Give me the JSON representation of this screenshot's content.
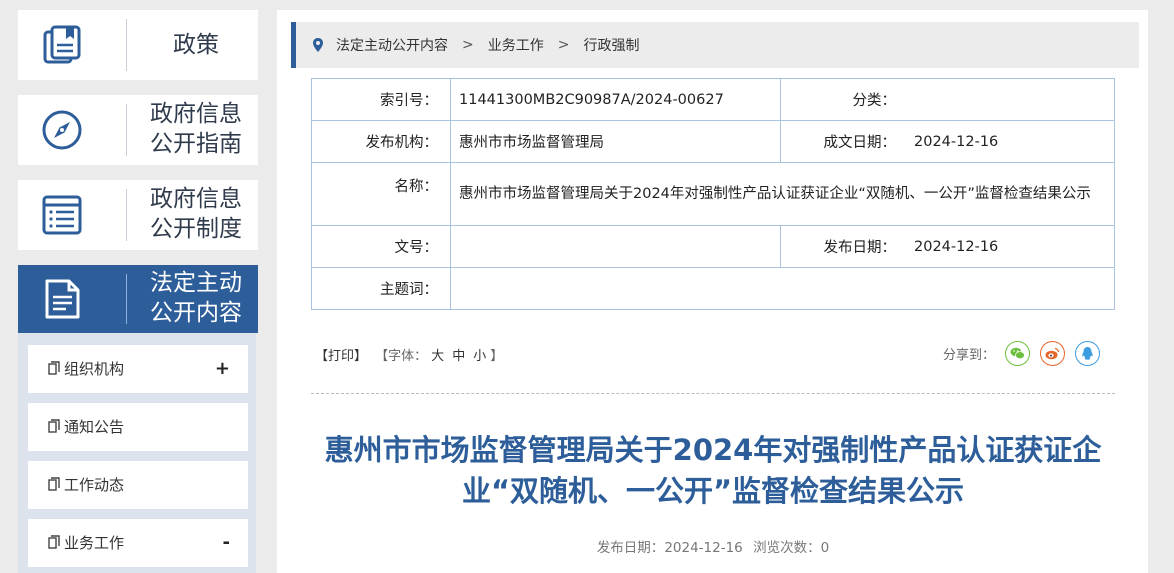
{
  "sidebar": {
    "cards": [
      {
        "label": "政策",
        "icon": "book-icon"
      },
      {
        "label": "政府信息公开指南",
        "line1": "政府信息",
        "line2": "公开指南",
        "icon": "compass-icon"
      },
      {
        "label": "政府信息公开制度",
        "line1": "政府信息",
        "line2": "公开制度",
        "icon": "list-icon"
      },
      {
        "label": "法定主动公开内容",
        "line1": "法定主动",
        "line2": "公开内容",
        "icon": "document-icon"
      }
    ],
    "sub_items": [
      {
        "label": "组织机构",
        "toggle": "+"
      },
      {
        "label": "通知公告",
        "toggle": ""
      },
      {
        "label": "工作动态",
        "toggle": ""
      },
      {
        "label": "业务工作",
        "toggle": "-"
      }
    ]
  },
  "breadcrumb": {
    "items": [
      "法定主动公开内容",
      "业务工作",
      "行政强制"
    ],
    "separator": ">"
  },
  "meta": {
    "index_label": "索引号：",
    "index_value": "11441300MB2C90987A/2024-00627",
    "category_label": "分类：",
    "category_value": "",
    "publisher_label": "发布机构：",
    "publisher_value": "惠州市市场监督管理局",
    "created_label": "成文日期：",
    "created_value": "2024-12-16",
    "name_label": "名称：",
    "name_value": "惠州市市场监督管理局关于2024年对强制性产品认证获证企业“双随机、一公开”监督检查结果公示",
    "docno_label": "文号：",
    "docno_value": "",
    "pubdate_label": "发布日期：",
    "pubdate_value": "2024-12-16",
    "keyword_label": "主题词：",
    "keyword_value": ""
  },
  "toolbar": {
    "print": "【打印】",
    "font_prefix": "【字体：",
    "font_large": "大",
    "font_medium": "中",
    "font_small": "小",
    "font_suffix": "】",
    "share_label": "分享到："
  },
  "article": {
    "title": "惠州市市场监督管理局关于2024年对强制性产品认证获证企业“双随机、一公开”监督检查结果公示",
    "pub_label": "发布日期：",
    "pub_date": "2024-12-16",
    "views_label": "浏览次数：",
    "views": "0"
  },
  "colors": {
    "accent": "#2d5e9a",
    "wechat": "#6cbf3c",
    "weibo": "#e6652a",
    "qq": "#3d9be0"
  }
}
